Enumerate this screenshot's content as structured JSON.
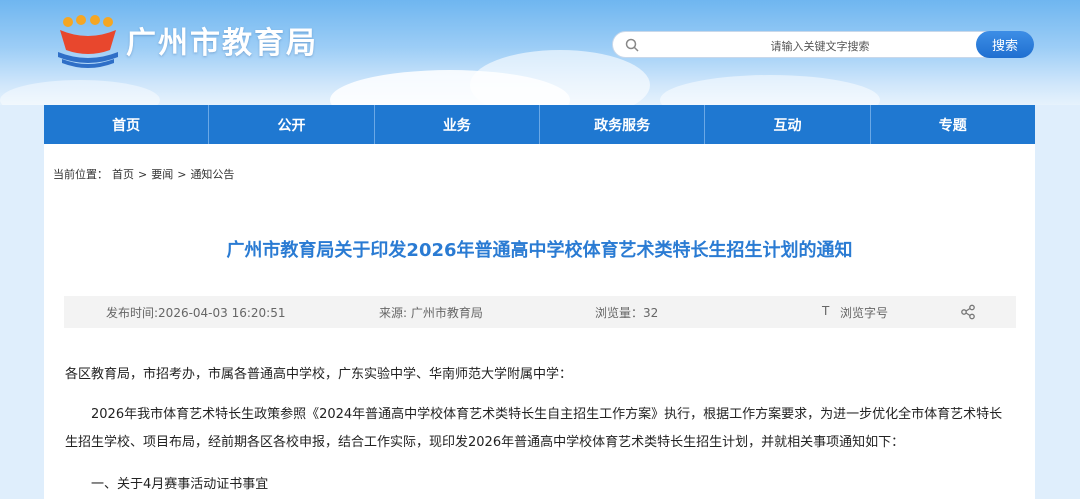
{
  "header": {
    "site_title": "广州市教育局",
    "search_placeholder": "请输入关键文字搜索",
    "search_button": "搜索"
  },
  "nav": [
    "首页",
    "公开",
    "业务",
    "政务服务",
    "互动",
    "专题"
  ],
  "breadcrumb": {
    "prefix": "当前位置：",
    "items": [
      "首页",
      ">",
      "要闻",
      ">",
      "通知公告"
    ]
  },
  "article": {
    "title": "广州市教育局关于印发2026年普通高中学校体育艺术类特长生招生计划的通知",
    "meta": {
      "published": "发布时间:2026-04-03 16:20:51",
      "source": "来源: 广州市教育局",
      "views": "浏览量：32",
      "font_size_icon": "T",
      "font_size_label": "浏览字号"
    },
    "salutation": "各区教育局，市招考办，市属各普通高中学校，广东实验中学、华南师范大学附属中学：",
    "body_line1": "2026年我市体育艺术特长生政策参照《2024年普通高中学校体育艺术类特长生自主招生工作方案》执行，根据工作方案要求，为进一步优化全市体育艺术特长",
    "body_line2": "生招生学校、项目布局，经前期各区各校申报，结合工作实际，现印发2026年普通高中学校体育艺术类特长生招生计划，并就相关事项通知如下：",
    "section1": "一、关于4月赛事活动证书事宜"
  },
  "colors": {
    "nav_bg": "#1f78d1",
    "title": "#2a7bd3",
    "search_button": "#1f6fd0"
  }
}
